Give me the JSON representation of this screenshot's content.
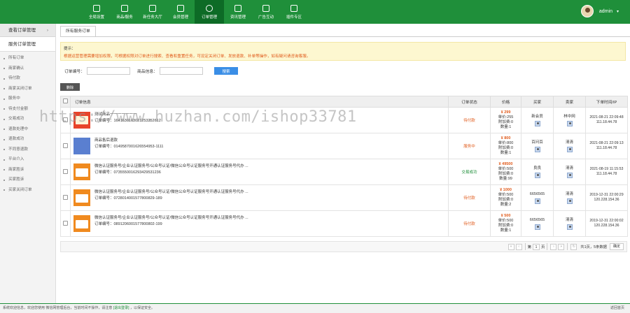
{
  "topnav": {
    "items": [
      {
        "label": "全局设置",
        "icon": "settings-icon"
      },
      {
        "label": "商品/服务",
        "icon": "goods-icon"
      },
      {
        "label": "新任务大厅",
        "icon": "task-hall-icon"
      },
      {
        "label": "会员管理",
        "icon": "member-icon"
      },
      {
        "label": "订单管理",
        "icon": "order-icon",
        "active": true
      },
      {
        "label": "资讯管理",
        "icon": "news-icon"
      },
      {
        "label": "广告互动",
        "icon": "ad-icon"
      },
      {
        "label": "插件专区",
        "icon": "plugin-icon"
      }
    ],
    "user": "admin"
  },
  "sidebar": {
    "section1": "查看订单管理",
    "section2": "服务订单管理",
    "items": [
      "所有订单",
      "商家确认",
      "待付款",
      "商家关闭订单",
      "服务中",
      "待支付金额",
      "交易成功",
      "退款处理中",
      "退款成功",
      "不同意退款",
      "平台介入",
      "商家胜诉",
      "买家胜诉",
      "买家关闭订单"
    ]
  },
  "tab": "所有服务订单",
  "tip": {
    "title": "提示：",
    "text": "根据运营管理需要增加权限，可根据权限对订单进行搜索、查看和重置任务，可设定关闭订单、发放退款、补单等操作，如有疑问请咨询客服。"
  },
  "search": {
    "order_label": "订单编号：",
    "merchant_label": "商品信息：",
    "button": "搜索"
  },
  "delete_button": "删除",
  "table": {
    "headers": [
      "订单信息",
      "订单状态",
      "价格",
      "买家",
      "卖家",
      "下单时间/IP"
    ],
    "rows": [
      {
        "thumb": "red",
        "name": "测试商品一一一一一一一",
        "order_no": "订单编号：1641630163021253252612",
        "status": "待付款",
        "status_type": "pay",
        "price": "¥ 299",
        "unit": "单价:255",
        "extra": "附加费:0",
        "qty": "数量:1",
        "buyer": "新会员",
        "seller": "林中网",
        "time": "2021-08-21 22:09:48",
        "ip": "111.18.44.78"
      },
      {
        "thumb": "blue",
        "name": "商品售后退款",
        "order_no": "订单编号：0149587001626554953-1111",
        "status": "服务中",
        "status_type": "pay",
        "price": "¥ 800",
        "unit": "单价:800",
        "extra": "附加费:0",
        "qty": "数量:1",
        "buyer": "百问百",
        "seller": "清清",
        "time": "2021-08-21 22:09:13",
        "ip": "111.18.44.78"
      },
      {
        "thumb": "orange",
        "name": "微信认证服务号/企业认证服务号/公众号认证/微信公众号认证服务号开通认证服务号代办 ...",
        "order_no": "订单编号：0735550016293429531236",
        "status": "交易成功",
        "status_type": "ok",
        "price": "¥ 49500",
        "unit": "单价:500",
        "extra": "附加费:0",
        "qty": "数量:99",
        "buyer": "良良",
        "seller": "清清",
        "time": "2021-08-19 11:15:53",
        "ip": "111.18.44.78"
      },
      {
        "thumb": "orange",
        "name": "微信认证服务号/企业认证服务号/公众号认证/微信公众号认证服务号开通认证服务号代办 ...",
        "order_no": "订单编号：0728014001577800829-189",
        "status": "待付款",
        "status_type": "pay",
        "price": "¥ 1000",
        "unit": "单价:500",
        "extra": "附加费:0",
        "qty": "数量:2",
        "buyer": "6656565",
        "seller": "清清",
        "time": "2019-12-31 22:00:29",
        "ip": "120.228.154.36"
      },
      {
        "thumb": "orange",
        "name": "微信认证服务号/企业认证服务号/公众号认证/微信公众号认证服务号开通认证服务号代办 ...",
        "order_no": "订单编号：0891206001577800802-199",
        "status": "待付款",
        "status_type": "pay",
        "price": "¥ 500",
        "unit": "单价:500",
        "extra": "附加费:0",
        "qty": "数量:1",
        "buyer": "6656565",
        "seller": "清清",
        "time": "2019-12-31 22:00:02",
        "ip": "120.228.154.36"
      }
    ]
  },
  "pager": {
    "page": "1",
    "of": "页",
    "total": "共1页，5条数据",
    "ok": "确定",
    "prefix": "第",
    "suffix": "页"
  },
  "watermark": "https://www.huzhan.com/ishop33781",
  "footer": {
    "text": "系统欢迎信息，欢迎您使用 微信网管理后台，当前时间不操作，请注意",
    "link": "[退出登录]",
    "text2": "，以保证安全。",
    "right": "返回首页"
  }
}
